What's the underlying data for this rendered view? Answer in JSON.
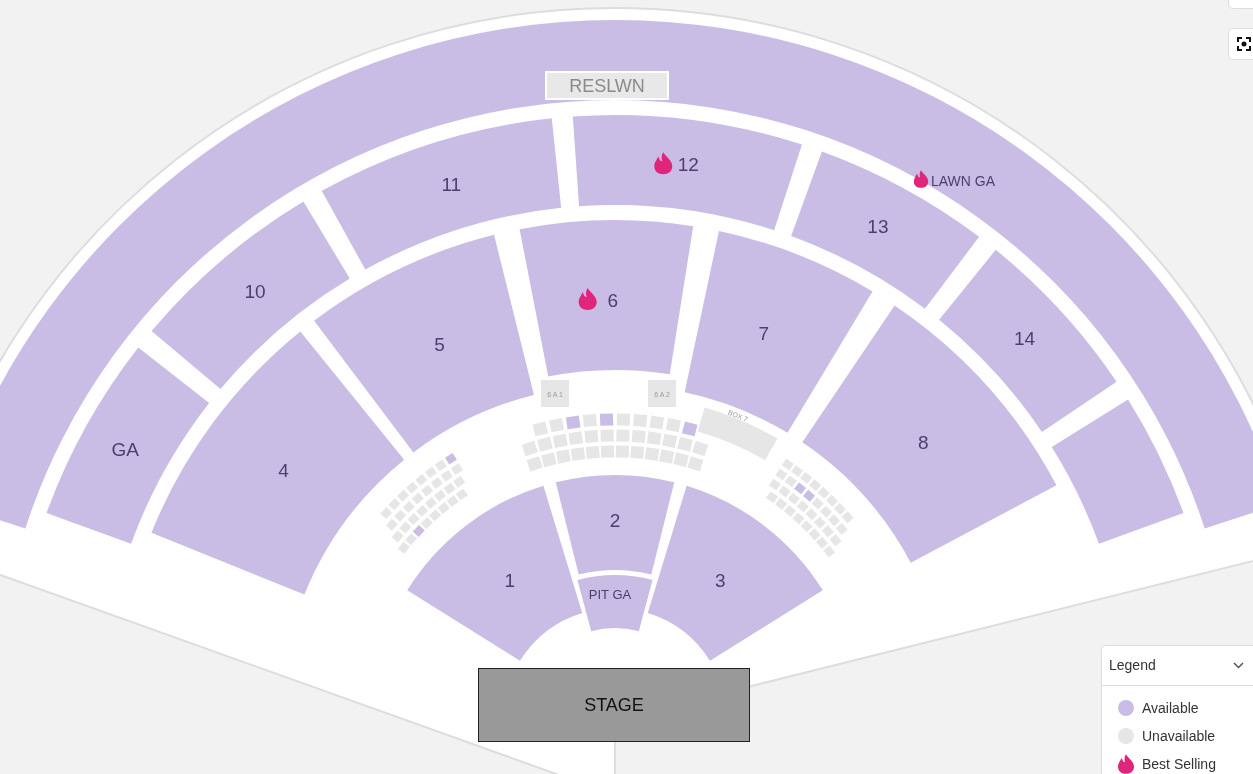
{
  "reserved_lawn": {
    "label": "RESLWN",
    "available": false
  },
  "lawn": {
    "label": "LAWN GA",
    "available": true,
    "best_selling": true
  },
  "sections": [
    {
      "label": "GA",
      "available": true,
      "best_selling": false
    },
    {
      "label": "10",
      "available": true,
      "best_selling": false
    },
    {
      "label": "11",
      "available": true,
      "best_selling": false
    },
    {
      "label": "12",
      "available": true,
      "best_selling": true
    },
    {
      "label": "13",
      "available": true,
      "best_selling": false
    },
    {
      "label": "14",
      "available": true,
      "best_selling": false
    },
    {
      "available": true,
      "best_selling": false
    },
    {
      "label": "4",
      "available": true,
      "best_selling": false
    },
    {
      "label": "5",
      "available": true,
      "best_selling": false
    },
    {
      "label": "6",
      "available": true,
      "best_selling": true
    },
    {
      "label": "7",
      "available": true,
      "best_selling": false
    },
    {
      "label": "8",
      "available": true,
      "best_selling": false
    },
    {
      "label": "1",
      "available": true,
      "best_selling": false
    },
    {
      "label": "2",
      "available": true,
      "best_selling": false
    },
    {
      "label": "3",
      "available": true,
      "best_selling": false
    }
  ],
  "pit": {
    "label": "PIT GA",
    "available": true
  },
  "boxes": [
    {
      "label": "6 A 1",
      "available": false
    },
    {
      "label": "6 A 2",
      "available": false
    },
    {
      "label": "BOX 7",
      "available": false
    }
  ],
  "box_clusters": [
    {
      "rows": [
        [
          false,
          false,
          true,
          false,
          true,
          false,
          false,
          false,
          false,
          true
        ],
        [
          false,
          false,
          false,
          false,
          false,
          false,
          false,
          false,
          false,
          false,
          false,
          false
        ],
        [
          false,
          false,
          false,
          false,
          false,
          false,
          false,
          false,
          false,
          false,
          false,
          false
        ]
      ]
    },
    {
      "rows": [
        [
          false,
          false,
          false,
          false,
          false,
          false,
          false,
          true
        ],
        [
          false,
          false,
          false,
          false,
          false,
          false,
          false,
          false
        ],
        [
          false,
          false,
          false,
          false,
          false,
          false,
          false,
          false
        ],
        [
          false,
          false,
          true,
          false,
          false,
          false,
          false,
          false
        ]
      ]
    },
    {
      "rows": [
        [
          false,
          false,
          false,
          false,
          false,
          false,
          false,
          false
        ],
        [
          false,
          false,
          true,
          true,
          false,
          false,
          false,
          false
        ],
        [
          false,
          false,
          false,
          false,
          false,
          false,
          false,
          false
        ],
        [
          false,
          false,
          false,
          false,
          false,
          false,
          false,
          false
        ]
      ]
    }
  ],
  "stage": "STAGE",
  "legend": {
    "title": "Legend",
    "expanded": true,
    "items": [
      {
        "kind": "available",
        "label": "Available"
      },
      {
        "kind": "unavailable",
        "label": "Unavailable"
      },
      {
        "kind": "best_selling",
        "label": "Best Selling"
      }
    ]
  }
}
